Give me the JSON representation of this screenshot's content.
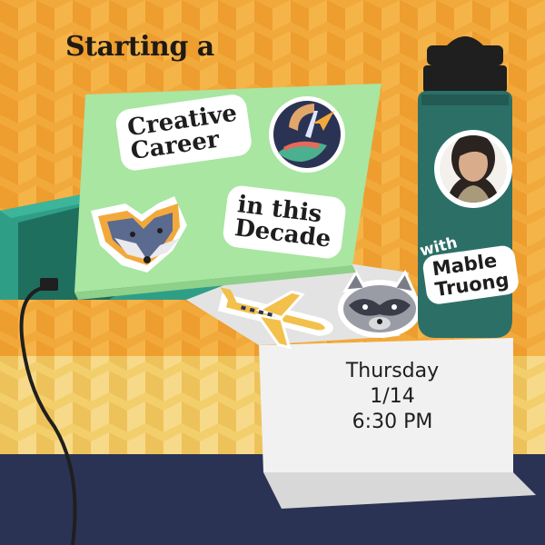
{
  "headline": "Starting a",
  "sticker_title_1": {
    "line1": "Creative",
    "line2": "Career"
  },
  "sticker_title_2": {
    "line1": "in this",
    "line2": "Decade"
  },
  "host": {
    "with_label": "with",
    "first_name": "Mable",
    "last_name": "Truong"
  },
  "event": {
    "day": "Thursday",
    "date": "1/14",
    "time": "6:30 PM"
  },
  "colors": {
    "background_orange": "#f2a93b",
    "floor_yellow": "#f3cf6b",
    "floor_navy": "#2b3354",
    "laptop_screen": "#a8e6a1",
    "laptop_body": "#2f9e87",
    "bottle_body": "#2c6f67",
    "bottle_cap": "#1f1f1f",
    "card_grey": "#ececec"
  },
  "icons": [
    "logo-sticker-icon",
    "fox-sticker-icon",
    "airplane-sticker-icon",
    "raccoon-sticker-icon",
    "power-cable-icon",
    "host-avatar"
  ]
}
